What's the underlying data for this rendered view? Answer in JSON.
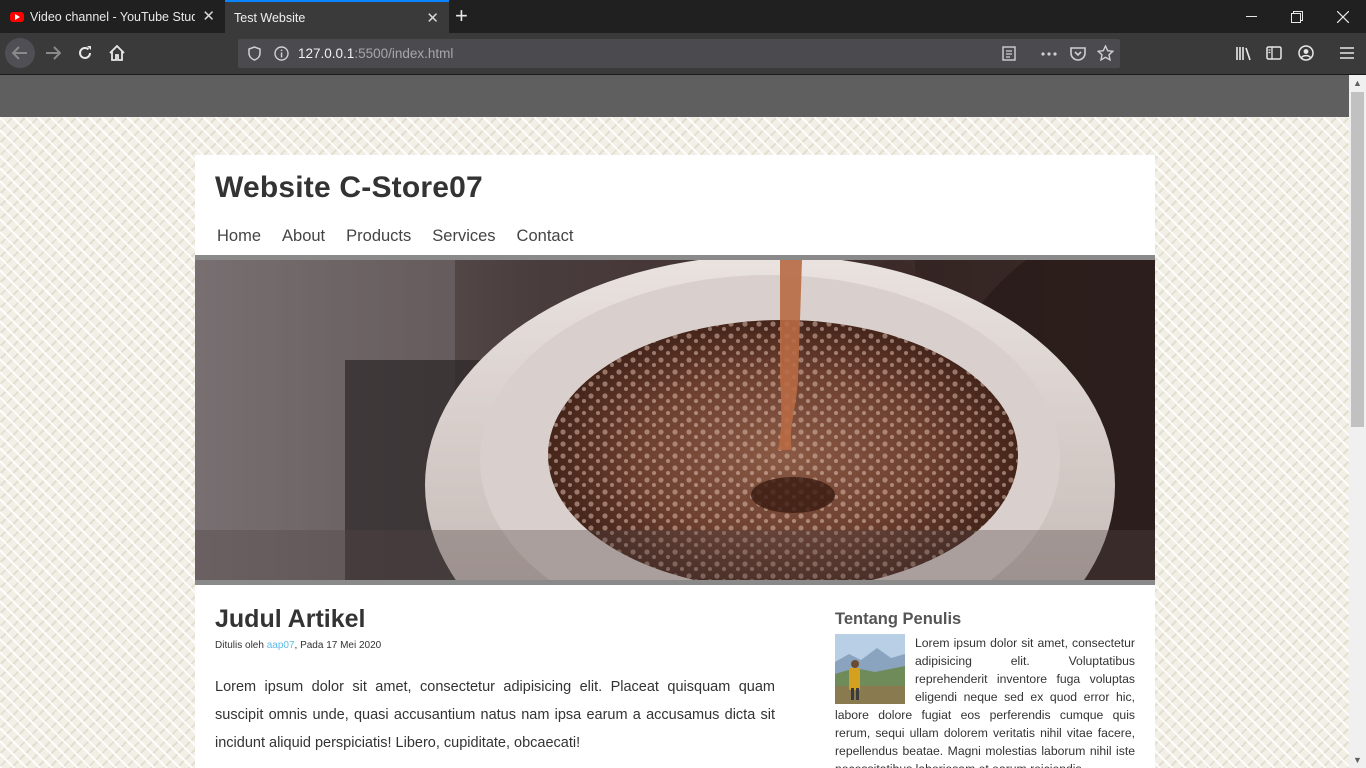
{
  "browser": {
    "tabs": [
      {
        "title": "Video channel - YouTube Studio",
        "active": false,
        "icon": "youtube-icon"
      },
      {
        "title": "Test Website",
        "active": true
      }
    ],
    "url_host": "127.0.0.1",
    "url_rest": ":5500/index.html",
    "accent": "#0a84ff"
  },
  "site": {
    "title": "Website C-Store07",
    "menu": [
      "Home",
      "About",
      "Products",
      "Services",
      "Contact"
    ]
  },
  "article": {
    "title": "Judul Artikel",
    "byline_prefix": "Ditulis oleh ",
    "author": "aap07",
    "byline_suffix": ", Pada 17 Mei 2020",
    "body": "Lorem ipsum dolor sit amet, consectetur adipisicing elit. Placeat quisquam quam suscipit omnis unde, quasi accusantium natus nam ipsa earum a accusamus dicta sit incidunt aliquid perspiciatis! Libero, cupiditate, obcaecati!"
  },
  "sidebar": {
    "title": "Tentang Penulis",
    "text": "Lorem ipsum dolor sit amet, consectetur adipisicing elit. Voluptatibus reprehenderit inventore fuga voluptas eligendi neque sed ex quod error hic, labore dolore fugiat eos perferendis cumque quis rerum, sequi ullam dolorem veritatis nihil vitae facere, repellendus beatae. Magni molestias laborum nihil iste necessitatibus laboriosam et earum reiciendis"
  },
  "colors": {
    "link": "#5dbce8",
    "page_bg": "#f2efe6",
    "header_bar": "#5f5f5f"
  }
}
